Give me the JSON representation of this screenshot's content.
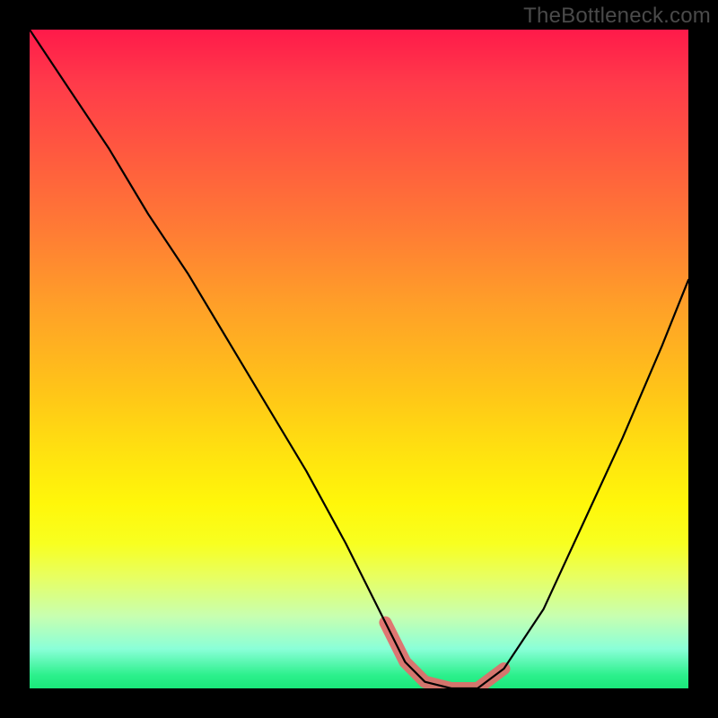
{
  "watermark": {
    "text": "TheBottleneck.com"
  },
  "chart_data": {
    "type": "line",
    "title": "",
    "xlabel": "",
    "ylabel": "",
    "xlim": [
      0,
      100
    ],
    "ylim": [
      0,
      100
    ],
    "grid": false,
    "legend": false,
    "background": "vertical-gradient red→yellow→green",
    "series": [
      {
        "name": "bottleneck-curve",
        "x": [
          0,
          6,
          12,
          18,
          24,
          30,
          36,
          42,
          48,
          54,
          57,
          60,
          64,
          68,
          72,
          78,
          84,
          90,
          96,
          100
        ],
        "y": [
          100,
          91,
          82,
          72,
          63,
          53,
          43,
          33,
          22,
          10,
          4,
          1,
          0,
          0,
          3,
          12,
          25,
          38,
          52,
          62
        ]
      }
    ],
    "annotations": [
      {
        "name": "optimal-zone-highlight",
        "color": "#e36a6a",
        "x": [
          54,
          57,
          60,
          64,
          68,
          72
        ],
        "y": [
          10,
          4,
          1,
          0,
          0,
          3
        ]
      }
    ],
    "notes": "Values estimated from pixel positions; chart has no axis ticks or labels. y=100 is top, y=0 is bottom (minimum bottleneck)."
  }
}
